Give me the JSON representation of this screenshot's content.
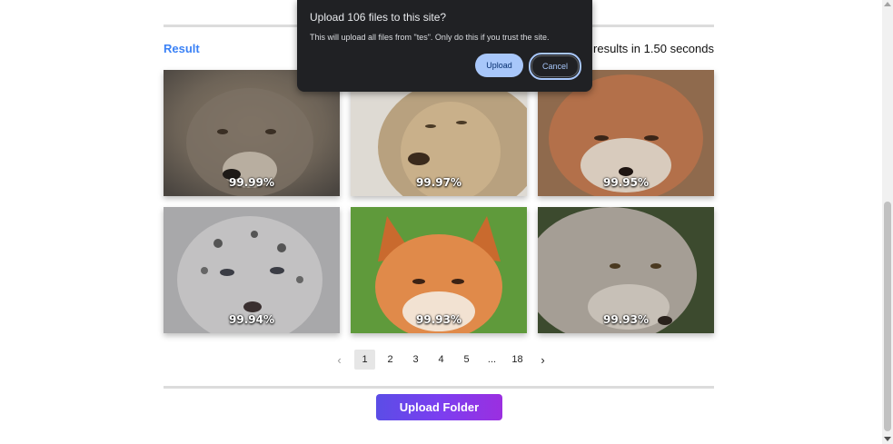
{
  "result": {
    "label": "Result",
    "stats": "106 results in 1.50 seconds"
  },
  "cards": [
    {
      "animal": "wolf",
      "score": "99.99%"
    },
    {
      "animal": "lion",
      "score": "99.97%"
    },
    {
      "animal": "fox",
      "score": "99.95%"
    },
    {
      "animal": "snow-leopard",
      "score": "99.94%"
    },
    {
      "animal": "fox",
      "score": "99.93%"
    },
    {
      "animal": "wolf",
      "score": "99.93%"
    }
  ],
  "pagination": {
    "prev_icon": "chevron-left-icon",
    "pages": [
      "1",
      "2",
      "3",
      "4",
      "5",
      "...",
      "18"
    ],
    "active": "1",
    "next_icon": "chevron-right-icon"
  },
  "upload_folder_label": "Upload Folder",
  "dialog": {
    "title": "Upload 106 files to this site?",
    "body": "This will upload all files from \"tes\". Only do this if you trust the site.",
    "upload_label": "Upload",
    "cancel_label": "Cancel"
  },
  "colors": {
    "accent": "#3b82f6",
    "dialog_bg": "#202124",
    "dialog_button": "#a8c7fa",
    "upload_gradient_start": "#5b4de6",
    "upload_gradient_end": "#9b2fe0"
  }
}
